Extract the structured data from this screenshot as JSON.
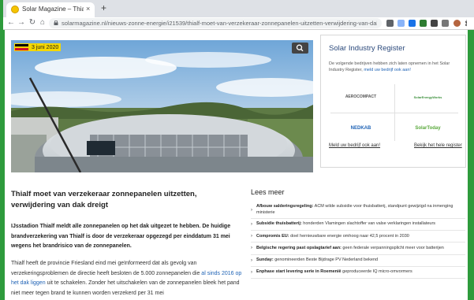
{
  "browser": {
    "tab_title": "Solar Magazine – Thialf moet ver...",
    "tab_close": "×",
    "new_tab": "+",
    "url": "solarmagazine.nl/nieuws-zonne-energie/i21539/thialf-moet-van-verzekeraar-zonnepanelen-uitzetten-verwijdering-van-dak-dreigt",
    "back": "←",
    "forward": "→",
    "reload": "↻",
    "home": "⌂"
  },
  "hero": {
    "date": "3 juni 2020",
    "flag_colors": [
      "#000000",
      "#f6d200",
      "#d0102c"
    ]
  },
  "sidebar": {
    "title": "Solar Industry Register",
    "description": "De volgende bedrijven hebben zich laten opnemen in het Solar Industry Register,",
    "description_link": "meld uw bedrijf ook aan!",
    "logos": [
      {
        "name": "AEROCOMPACT",
        "color": "#555555"
      },
      {
        "name": "SolarEnergyWorks",
        "color": "#3a8f3a"
      },
      {
        "name": "NEDKAB",
        "color": "#1e62b5"
      },
      {
        "name": "SolarToday",
        "color": "#58a83a"
      }
    ],
    "link_left": "Meld uw bedrijf ook aan!",
    "link_right": "Bekijk het hele register"
  },
  "article": {
    "title": "Thialf moet van verzekeraar zonnepanelen uitzetten, verwijdering van dak dreigt",
    "lead": "IJsstadion Thialf meldt alle zonnepanelen op het dak uitgezet te hebben. De huidige brandverzekering van Thialf is door de verzekeraar opgezegd per einddatum 31 mei wegens het brandrisico van de zonnepanelen.",
    "body_1": "Thialf heeft de provincie Friesland eind mei geïnformeerd dat als gevolg van verzekeringsproblemen de directie heeft besloten de 5.000 zonnepanelen die",
    "body_link": "al sinds 2016 op het dak liggen",
    "body_2": "uit te schakelen. Zonder het uitschakelen van de zonnepanelen bleek het pand niet meer tegen brand te kunnen worden verzekerd per 31 mei"
  },
  "lees_meer": {
    "title": "Lees meer",
    "items": [
      {
        "bold": "Afbouw salderingsregeling:",
        "text": " ACM wilde subsidie voor thuisbatterij, standpunt gewijzigd na inmenging ministerie",
        "tall": true
      },
      {
        "bold": "Subsidie thuisbatterij:",
        "text": " honderden Vlamingen slachtoffer van valse verklaringen installateurs",
        "tall": false
      },
      {
        "bold": "Compromis EU:",
        "text": " doel hernieuwbare energie omhoog naar 42,5 procent in 2030",
        "tall": false
      },
      {
        "bold": "Belgische regering past opslagtarief aan:",
        "text": " geen federale verpanningsplicht meer voor batterijen",
        "tall": false
      },
      {
        "bold": "Sunday:",
        "text": " genomineerden Beste Bijdrage PV Nederland bekend",
        "tall": false
      },
      {
        "bold": "Enphase start levering serie in Roemenië",
        "text": " geproduceerde IQ micro-omvormers",
        "tall": false
      }
    ]
  }
}
